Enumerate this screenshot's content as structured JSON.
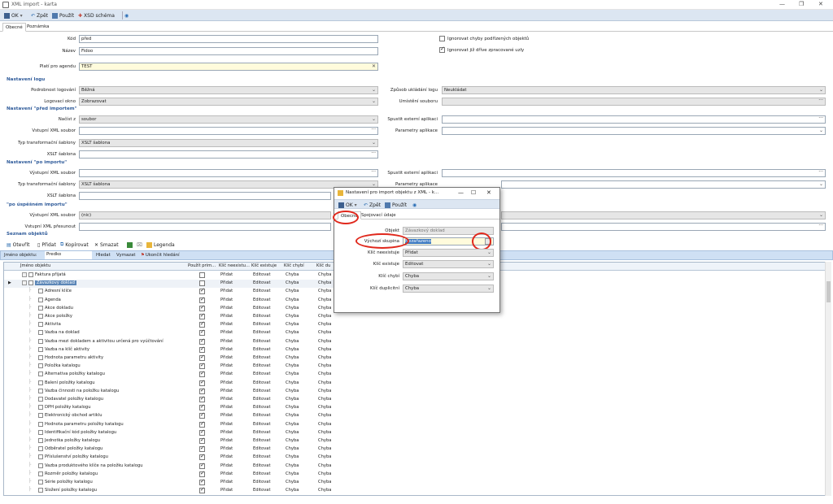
{
  "window": {
    "title": "XML import - karta",
    "controls": [
      "—",
      "❐",
      "✕"
    ]
  },
  "toolbar": {
    "ok": "OK",
    "back": "Zpět",
    "apply": "Použít",
    "xsd": "XSD schéma"
  },
  "tabs": [
    "Obecné",
    "Poznámka"
  ],
  "general": {
    "kod_label": "Kód",
    "kod_value": "před",
    "nazev_label": "Název",
    "nazev_value": "Fidoo",
    "plati_label": "Platí pro agendu",
    "plati_value": "TEST",
    "ignore_child_errors": "Ignorovat chyby podřízených objektů",
    "ignore_processed": "Ignorovat již dříve zpracované uzly"
  },
  "logging": {
    "section": "Nastavení logu",
    "detail_label": "Podrobnost logování",
    "detail_value": "Běžná",
    "window_label": "Logovací okno",
    "window_value": "Zobrazovat",
    "save_label": "Způsob ukládání logu",
    "save_value": "Neukládat",
    "location_label": "Umístění souboru",
    "location_value": ""
  },
  "before": {
    "section": "Nastavení \"před importem\"",
    "load_label": "Načíst z",
    "load_value": "soubor",
    "input_label": "Vstupní XML soubor",
    "input_value": "",
    "transform_label": "Typ transformační šablony",
    "transform_value": "XSLT šablona",
    "xslt_label": "XSLT šablona",
    "xslt_value": "",
    "ext_app_label": "Spustit externí aplikaci",
    "ext_app_value": "",
    "params_label": "Parametry aplikace",
    "params_value": ""
  },
  "after": {
    "section": "Nastavení \"po importu\"",
    "output_label": "Výstupní XML soubor",
    "output_value": "",
    "transform_label": "Typ transformační šablony",
    "transform_value": "XSLT šablona",
    "xslt_label": "XSLT šablona",
    "xslt_value": "",
    "ext_app_label": "Spustit externí aplikaci",
    "ext_app_value": "",
    "params_label": "Parametry aplikace",
    "params_value": ""
  },
  "success": {
    "section": "\"po úspěšném importu\"",
    "output_label": "Výstupní XML soubor",
    "output_value": "(nic)",
    "move_label": "Vstupní XML přesunout",
    "move_value": ""
  },
  "objects": {
    "section": "Seznam objektů",
    "toolbar": {
      "open": "Otevřít",
      "add": "Přidat",
      "copy": "Kopírovat",
      "delete": "Smazat",
      "legend": "Legenda"
    },
    "filter": {
      "label": "Jméno objektu:",
      "value": "Predko",
      "search": "Hledat",
      "clear": "Vymazat",
      "end": "Ukončit hledání"
    },
    "columns": [
      "Jméno objektu",
      "Použít prim...",
      "Klíč neexistu...",
      "Klíč existuje",
      "Klíč chybí",
      "Klíč du"
    ],
    "rows": [
      {
        "name": "Faktura přijatá",
        "level": 0,
        "checked": false,
        "ne": "Přidat",
        "ex": "Editovat",
        "ch": "Chyba",
        "du": "Chyba"
      },
      {
        "name": "Závazkový doklad",
        "level": 0,
        "checked": false,
        "ne": "Přidat",
        "ex": "Editovat",
        "ch": "Chyba",
        "du": "Chyba",
        "selected": true
      },
      {
        "name": "Adresní klíče",
        "level": 1,
        "checked": true,
        "ne": "Přidat",
        "ex": "Editovat",
        "ch": "Chyba",
        "du": "Chyba"
      },
      {
        "name": "Agenda",
        "level": 1,
        "checked": true,
        "ne": "Přidat",
        "ex": "Editovat",
        "ch": "Chyba",
        "du": "Chyba"
      },
      {
        "name": "Akce dokladu",
        "level": 1,
        "checked": true,
        "ne": "Přidat",
        "ex": "Editovat",
        "ch": "Chyba",
        "du": "Chyba"
      },
      {
        "name": "Akce položky",
        "level": 1,
        "checked": true,
        "ne": "Přidat",
        "ex": "Editovat",
        "ch": "Chyba",
        "du": "Chyba"
      },
      {
        "name": "Aktivita",
        "level": 1,
        "checked": true,
        "ne": "Přidat",
        "ex": "Editovat",
        "ch": "Chyba",
        "du": "Chyba"
      },
      {
        "name": "Vazba na doklad",
        "level": 1,
        "checked": true,
        "ne": "Přidat",
        "ex": "Editovat",
        "ch": "Chyba",
        "du": "Chyba"
      },
      {
        "name": "Vazba mezi dokladem a aktivitou určená pro vyúčtování",
        "level": 1,
        "checked": true,
        "ne": "Přidat",
        "ex": "Editovat",
        "ch": "Chyba",
        "du": "Chyba"
      },
      {
        "name": "Vazba na klíč aktivity",
        "level": 1,
        "checked": true,
        "ne": "Přidat",
        "ex": "Editovat",
        "ch": "Chyba",
        "du": "Chyba"
      },
      {
        "name": "Hodnota parametru aktivity",
        "level": 1,
        "checked": true,
        "ne": "Přidat",
        "ex": "Editovat",
        "ch": "Chyba",
        "du": "Chyba"
      },
      {
        "name": "Položka katalogu",
        "level": 1,
        "checked": true,
        "ne": "Přidat",
        "ex": "Editovat",
        "ch": "Chyba",
        "du": "Chyba"
      },
      {
        "name": "Alternativa položky katalogu",
        "level": 1,
        "checked": true,
        "ne": "Přidat",
        "ex": "Editovat",
        "ch": "Chyba",
        "du": "Chyba"
      },
      {
        "name": "Balení položky katalogu",
        "level": 1,
        "checked": true,
        "ne": "Přidat",
        "ex": "Editovat",
        "ch": "Chyba",
        "du": "Chyba"
      },
      {
        "name": "Vazba činnosti na položku katalogu",
        "level": 1,
        "checked": true,
        "ne": "Přidat",
        "ex": "Editovat",
        "ch": "Chyba",
        "du": "Chyba"
      },
      {
        "name": "Dodavatel položky katalogu",
        "level": 1,
        "checked": true,
        "ne": "Přidat",
        "ex": "Editovat",
        "ch": "Chyba",
        "du": "Chyba"
      },
      {
        "name": "DPH položky katalogu",
        "level": 1,
        "checked": true,
        "ne": "Přidat",
        "ex": "Editovat",
        "ch": "Chyba",
        "du": "Chyba"
      },
      {
        "name": "Elektronický obchod artiklu",
        "level": 1,
        "checked": true,
        "ne": "Přidat",
        "ex": "Editovat",
        "ch": "Chyba",
        "du": "Chyba"
      },
      {
        "name": "Hodnota parametru položky katalogu",
        "level": 1,
        "checked": true,
        "ne": "Přidat",
        "ex": "Editovat",
        "ch": "Chyba",
        "du": "Chyba"
      },
      {
        "name": "Identifikační kód položky katalogu",
        "level": 1,
        "checked": true,
        "ne": "Přidat",
        "ex": "Editovat",
        "ch": "Chyba",
        "du": "Chyba"
      },
      {
        "name": "Jednotka položky katalogu",
        "level": 1,
        "checked": true,
        "ne": "Přidat",
        "ex": "Editovat",
        "ch": "Chyba",
        "du": "Chyba"
      },
      {
        "name": "Odběratel položky katalogu",
        "level": 1,
        "checked": true,
        "ne": "Přidat",
        "ex": "Editovat",
        "ch": "Chyba",
        "du": "Chyba"
      },
      {
        "name": "Příslušenství položky katalogu",
        "level": 1,
        "checked": true,
        "ne": "Přidat",
        "ex": "Editovat",
        "ch": "Chyba",
        "du": "Chyba"
      },
      {
        "name": "Vazba produktového klíče na položku katalogu",
        "level": 1,
        "checked": true,
        "ne": "Přidat",
        "ex": "Editovat",
        "ch": "Chyba",
        "du": "Chyba"
      },
      {
        "name": "Rozměr položky katalogu",
        "level": 1,
        "checked": true,
        "ne": "Přidat",
        "ex": "Editovat",
        "ch": "Chyba",
        "du": "Chyba"
      },
      {
        "name": "Série položky katalogu",
        "level": 1,
        "checked": true,
        "ne": "Přidat",
        "ex": "Editovat",
        "ch": "Chyba",
        "du": "Chyba"
      },
      {
        "name": "Složení položky katalogu",
        "level": 1,
        "checked": true,
        "ne": "Přidat",
        "ex": "Editovat",
        "ch": "Chyba",
        "du": "Chyba"
      }
    ]
  },
  "dialog": {
    "title": "Nastavení pro import objektu z XML - k...",
    "controls": [
      "—",
      "☐",
      "✕"
    ],
    "toolbar": {
      "ok": "OK",
      "back": "Zpět",
      "apply": "Použít"
    },
    "tabs": [
      "Obecné",
      "Spojovací údaje"
    ],
    "objekt_label": "Objekt",
    "objekt_value": "Závazkový doklad",
    "group_label": "Výchozí skupina",
    "group_value": "Nezařazeno",
    "ne_label": "Klíč neexistuje",
    "ne_value": "Přidat",
    "ex_label": "Klíč existuje",
    "ex_value": "Editovat",
    "ch_label": "Klíč chybí",
    "ch_value": "Chyba",
    "du_label": "Klíč duplicitní",
    "du_value": "Chyba"
  }
}
